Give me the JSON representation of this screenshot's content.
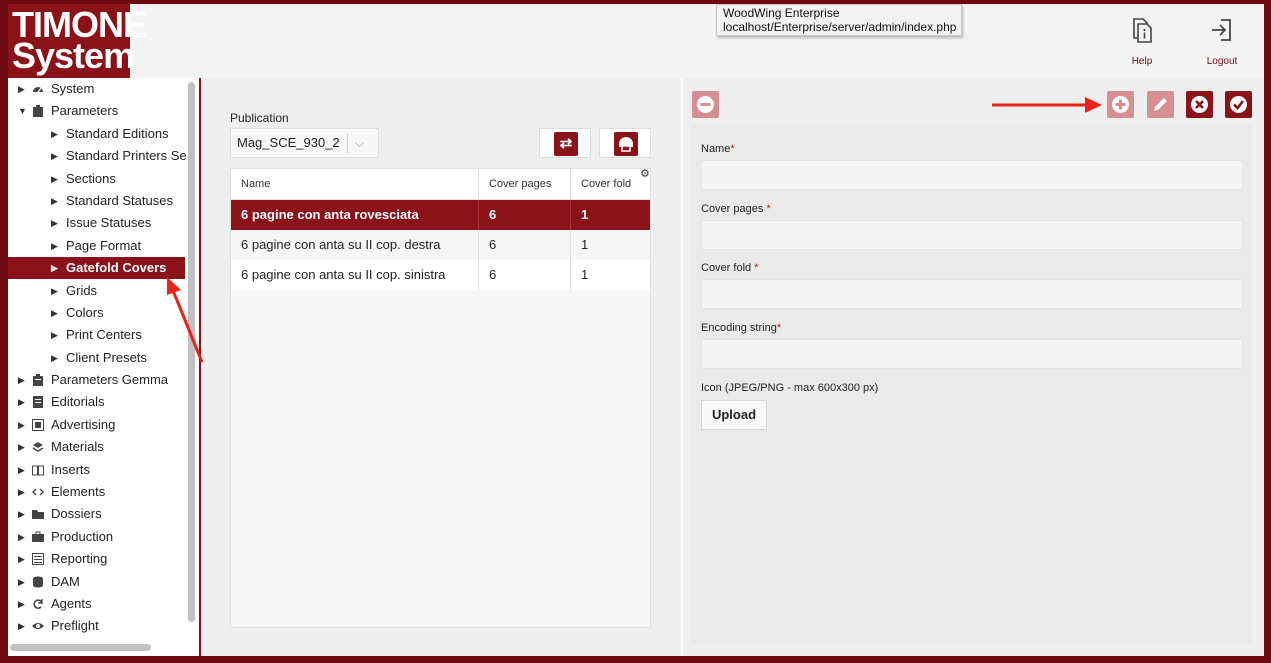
{
  "logo": {
    "line1": "TIMONE",
    "line2": "System"
  },
  "tooltip": {
    "line1": "WoodWing Enterprise",
    "line2": "localhost/Enterprise/server/admin/index.php"
  },
  "header": {
    "help_label": "Help",
    "logout_label": "Logout"
  },
  "sidebar": {
    "items": [
      {
        "label": "System",
        "icon": "gauge-icon",
        "expanded": false
      },
      {
        "label": "Parameters",
        "icon": "clipboard-icon",
        "expanded": true
      },
      {
        "label": "Standard Editions",
        "child": true
      },
      {
        "label": "Standard Printers Se",
        "child": true
      },
      {
        "label": "Sections",
        "child": true
      },
      {
        "label": "Standard Statuses",
        "child": true
      },
      {
        "label": "Issue Statuses",
        "child": true
      },
      {
        "label": "Page Format",
        "child": true
      },
      {
        "label": "Gatefold Covers",
        "child": true,
        "active": true
      },
      {
        "label": "Grids",
        "child": true
      },
      {
        "label": "Colors",
        "child": true
      },
      {
        "label": "Print Centers",
        "child": true
      },
      {
        "label": "Client Presets",
        "child": true
      },
      {
        "label": "Parameters Gemma",
        "icon": "clipboard-icon"
      },
      {
        "label": "Editorials",
        "icon": "document-icon"
      },
      {
        "label": "Advertising",
        "icon": "ad-icon"
      },
      {
        "label": "Materials",
        "icon": "layers-icon"
      },
      {
        "label": "Inserts",
        "icon": "book-icon"
      },
      {
        "label": "Elements",
        "icon": "code-icon"
      },
      {
        "label": "Dossiers",
        "icon": "folder-icon"
      },
      {
        "label": "Production",
        "icon": "briefcase-icon"
      },
      {
        "label": "Reporting",
        "icon": "list-icon"
      },
      {
        "label": "DAM",
        "icon": "database-icon"
      },
      {
        "label": "Agents",
        "icon": "sync-icon"
      },
      {
        "label": "Preflight",
        "icon": "eye-icon"
      }
    ]
  },
  "publication": {
    "label": "Publication",
    "value": "Mag_SCE_930_2"
  },
  "table": {
    "columns": [
      "Name",
      "Cover pages",
      "Cover fold"
    ],
    "rows": [
      {
        "name": "6 pagine con anta rovesciata",
        "cover_pages": "6",
        "cover_fold": "1",
        "selected": true
      },
      {
        "name": "6 pagine con anta su II cop. destra",
        "cover_pages": "6",
        "cover_fold": "1"
      },
      {
        "name": "6 pagine con anta su II cop. sinistra",
        "cover_pages": "6",
        "cover_fold": "1"
      }
    ]
  },
  "form": {
    "fields": [
      {
        "label": "Name",
        "required": "*"
      },
      {
        "label": "Cover pages",
        "required": "*"
      },
      {
        "label": "Cover fold",
        "required": "*"
      },
      {
        "label": "Encoding string",
        "required": "*"
      }
    ],
    "icon_label": "Icon (JPEG/PNG - max 600x300 px)",
    "upload_label": "Upload"
  },
  "colors": {
    "brand": "#8b1219",
    "brand_faded": "#d58f93",
    "annotation_arrow": "#e8231b"
  }
}
